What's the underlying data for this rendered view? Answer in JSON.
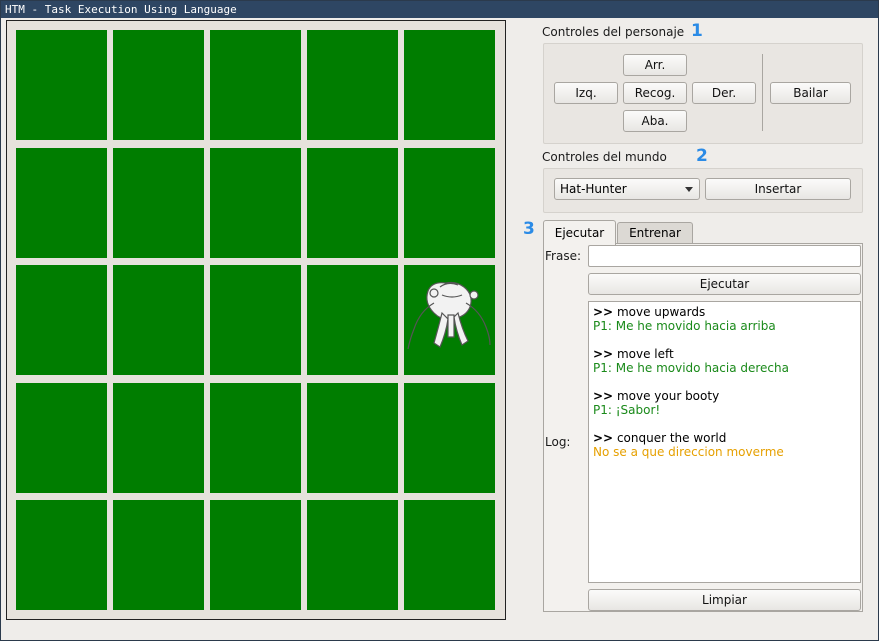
{
  "window": {
    "title": "HTM - Task Execution Using Language"
  },
  "colors": {
    "grass": "#007d00",
    "marker": "#2b8be6",
    "reply_ok": "#1a8a1a",
    "reply_warn": "#e6a000"
  },
  "world": {
    "rows": 5,
    "cols": 5,
    "creature": {
      "row": 2,
      "col": 4,
      "icon": "hat-hunter-creature-icon"
    }
  },
  "character_controls": {
    "title": "Controles del personaje",
    "marker": "1",
    "up": "Arr.",
    "left": "Izq.",
    "pick": "Recog.",
    "right": "Der.",
    "down": "Aba.",
    "dance": "Bailar"
  },
  "world_controls": {
    "title": "Controles del mundo",
    "marker": "2",
    "selected_entity": "Hat-Hunter",
    "insert": "Insertar"
  },
  "tabs": {
    "marker": "3",
    "items": [
      {
        "label": "Ejecutar",
        "active": true
      },
      {
        "label": "Entrenar",
        "active": false
      }
    ]
  },
  "execute": {
    "phrase_label": "Frase:",
    "phrase_value": "",
    "execute_button": "Ejecutar",
    "log_label": "Log:",
    "clear_button": "Limpiar"
  },
  "log": [
    {
      "prefix": ">>",
      "command": "move upwards",
      "reply": "P1: Me he movido hacia arriba",
      "status": "ok"
    },
    {
      "prefix": ">>",
      "command": "move left",
      "reply": "P1: Me he movido hacia derecha",
      "status": "ok"
    },
    {
      "prefix": ">>",
      "command": "move your booty",
      "reply": "P1: ¡Sabor!",
      "status": "ok"
    },
    {
      "prefix": ">>",
      "command": "conquer the world",
      "reply": "No se a que direccion moverme",
      "status": "warn"
    }
  ]
}
